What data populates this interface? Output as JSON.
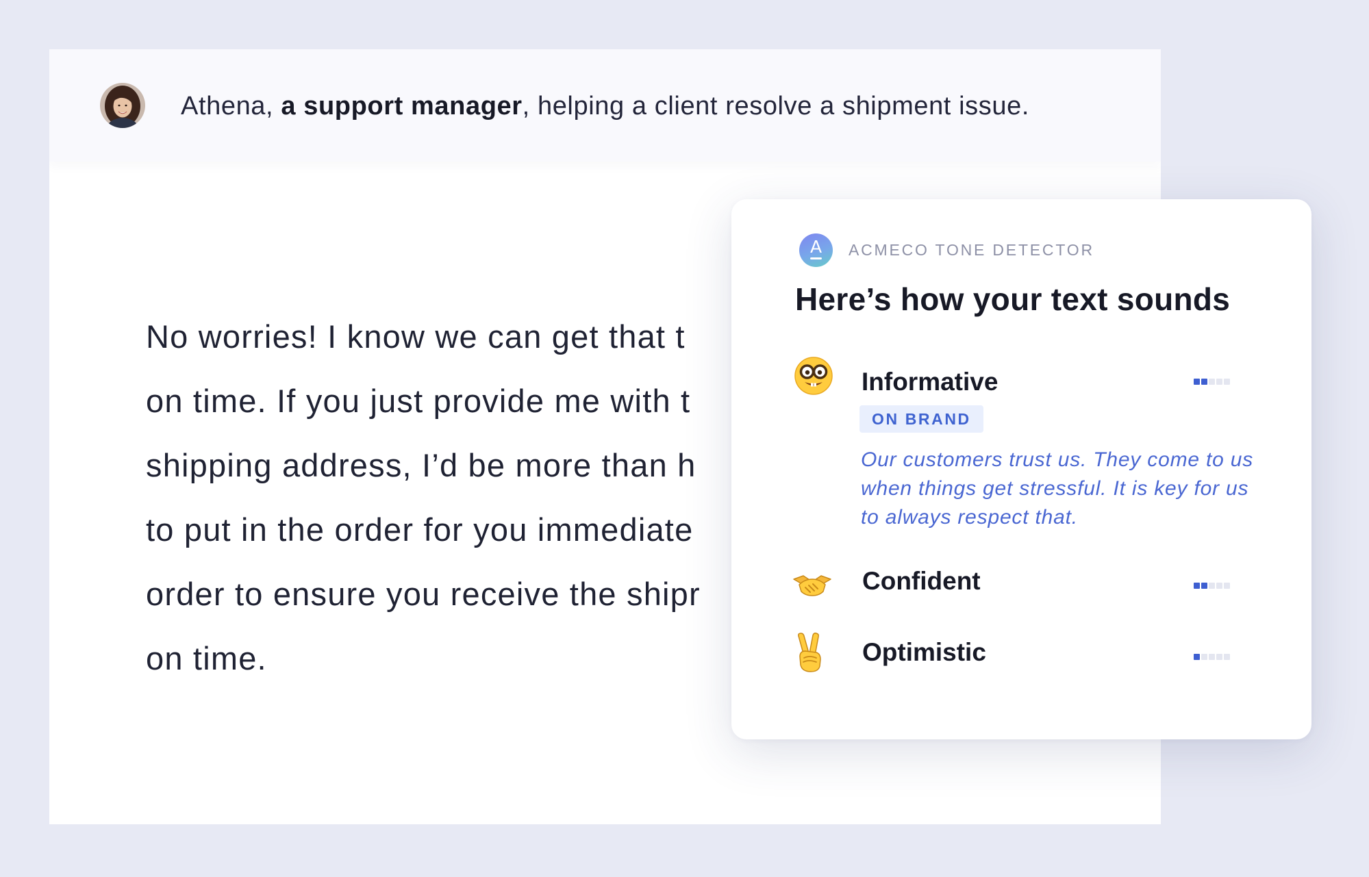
{
  "header": {
    "name": "Athena, ",
    "role": "a support manager",
    "context": ", helping a client resolve a shipment issue."
  },
  "document": {
    "lines": [
      "No worries! I know we can get that t",
      "on time. If you just provide me with t",
      "shipping address, I’d be more than h",
      "to put in the order for you immediate",
      "order to ensure you receive the shipr",
      "on time."
    ]
  },
  "tone_panel": {
    "brand_logo_letter": "A",
    "brand_name": "ACMECO TONE DETECTOR",
    "title": "Here’s how your text sounds",
    "tones": [
      {
        "name": "Informative",
        "icon": "nerd-face-icon",
        "level": 2,
        "max": 5
      },
      {
        "name": "Confident",
        "icon": "handshake-icon",
        "level": 2,
        "max": 5
      },
      {
        "name": "Optimistic",
        "icon": "victory-hand-icon",
        "level": 1,
        "max": 5
      }
    ],
    "badge": "ON BRAND",
    "brand_quote": "Our customers trust us. They come to us when things get stressful. It is key for us to always respect that."
  },
  "colors": {
    "background": "#e7e9f4",
    "accent": "#3e5fd1",
    "quote": "#4a67d2",
    "badge_bg": "#e9effd"
  }
}
